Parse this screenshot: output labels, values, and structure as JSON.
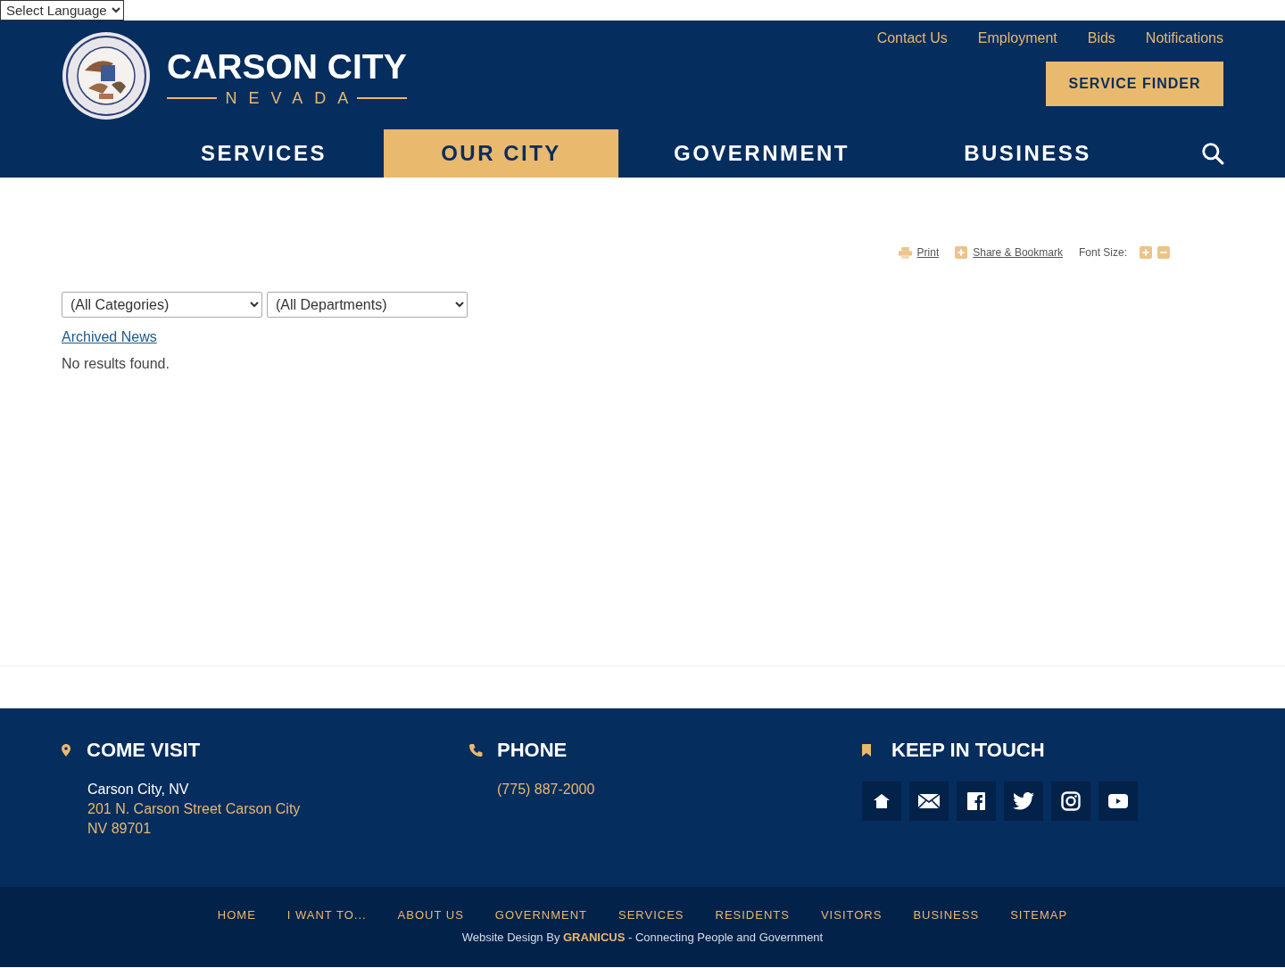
{
  "language_select": {
    "value": "Select Language"
  },
  "logo": {
    "title": "CARSON CITY",
    "subtitle": "NEVADA"
  },
  "utility_links": [
    "Contact Us",
    "Employment",
    "Bids",
    "Notifications"
  ],
  "service_finder": "SERVICE FINDER",
  "nav": [
    {
      "label": "SERVICES",
      "selected": false
    },
    {
      "label": "OUR CITY",
      "selected": true
    },
    {
      "label": "GOVERNMENT",
      "selected": false
    },
    {
      "label": "BUSINESS",
      "selected": false
    }
  ],
  "tools": {
    "print": "Print",
    "share": "Share & Bookmark",
    "font_size": "Font Size:"
  },
  "filters": [
    {
      "value": "(All Categories)"
    },
    {
      "value": "(All Departments)"
    }
  ],
  "archived_link": "Archived News",
  "message": "No results found.",
  "footer": [
    {
      "kind": "visit",
      "heading": "COME VISIT",
      "lines": [
        {
          "text": "Carson City, NV",
          "link": false
        },
        {
          "text": "201 N. Carson Street Carson City",
          "link": true
        },
        {
          "text": "NV 89701",
          "link": true
        }
      ]
    },
    {
      "kind": "phone",
      "heading": "PHONE",
      "lines": [
        {
          "text": "(775) 887-2000",
          "link": true
        }
      ]
    },
    {
      "kind": "touch",
      "heading": "KEEP IN TOUCH",
      "social": [
        {
          "kind": "home"
        },
        {
          "kind": "email"
        },
        {
          "kind": "facebook"
        },
        {
          "kind": "twitter"
        },
        {
          "kind": "instagram"
        },
        {
          "kind": "youtube"
        }
      ]
    }
  ],
  "bottom_links": [
    "HOME",
    "I WANT TO...",
    "ABOUT US",
    "GOVERNMENT",
    "SERVICES",
    "RESIDENTS",
    "VISITORS",
    "BUSINESS",
    "SITEMAP"
  ],
  "credit": "Website Design By **GRANICUS** - Connecting People and Government"
}
